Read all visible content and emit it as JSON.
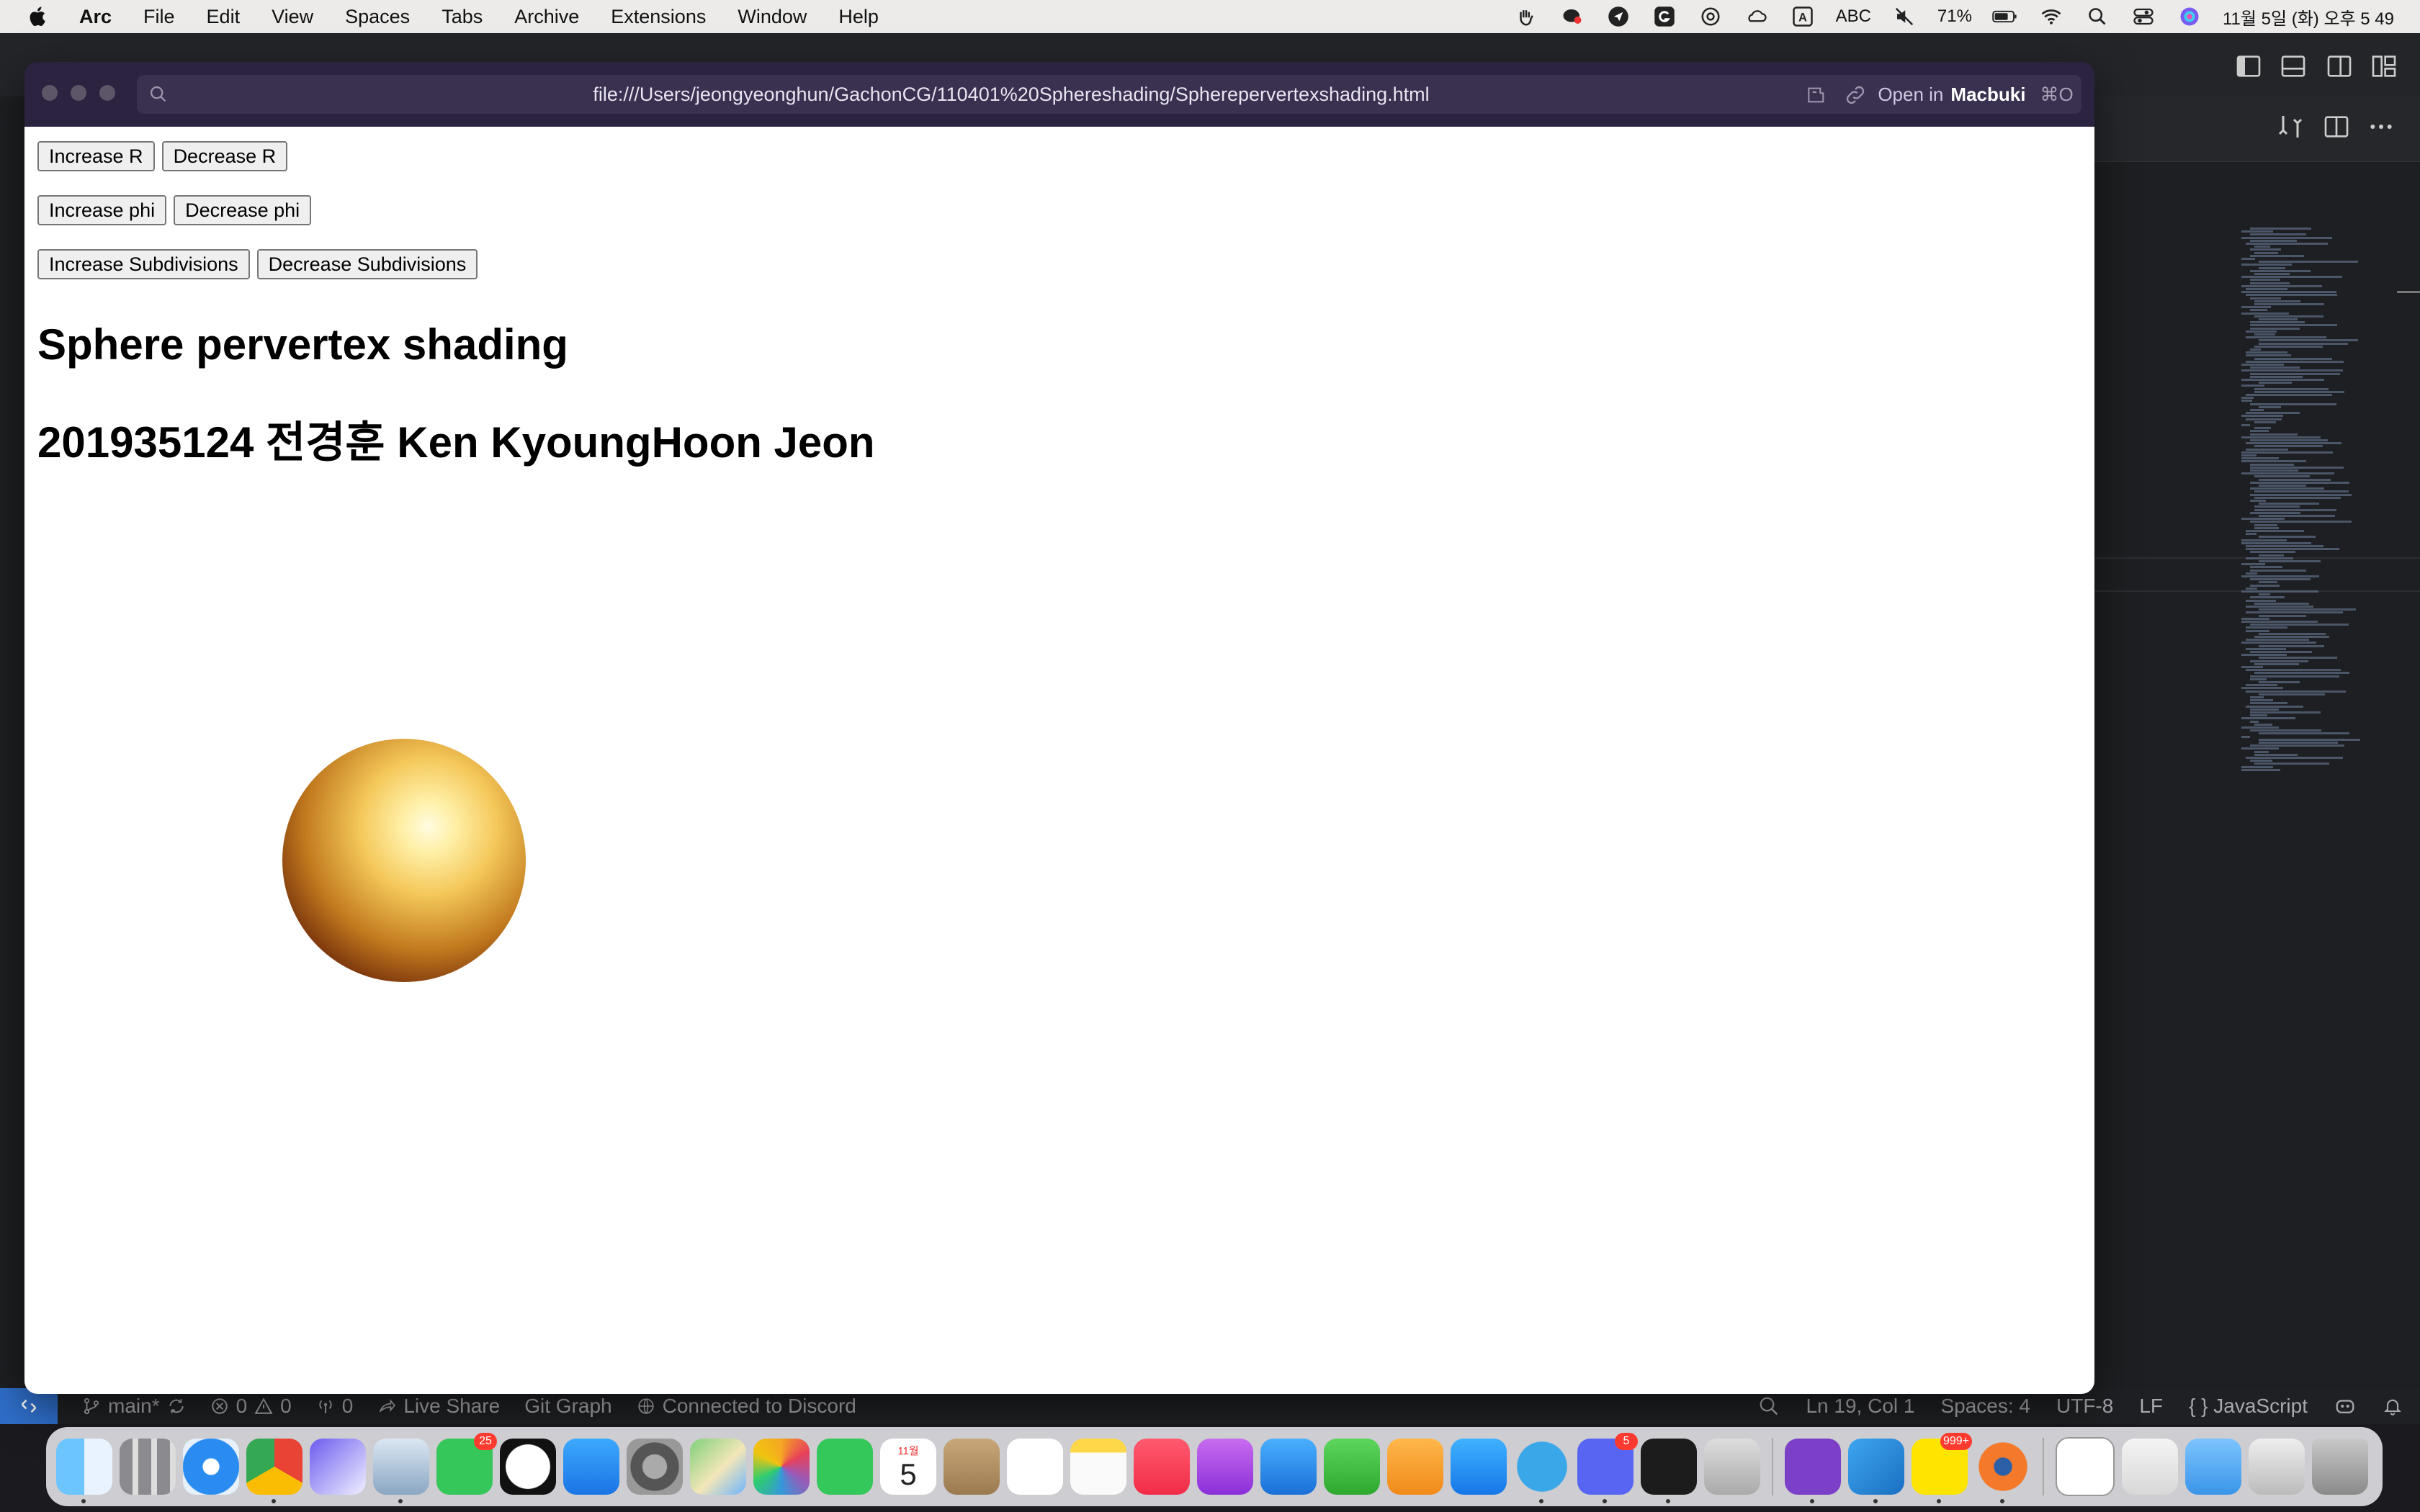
{
  "menubar": {
    "app": "Arc",
    "items": [
      "File",
      "Edit",
      "View",
      "Spaces",
      "Tabs",
      "Archive",
      "Extensions",
      "Window",
      "Help"
    ],
    "status": {
      "input_source_letter": "A",
      "input_source": "ABC",
      "battery": "71%",
      "datetime": "11월 5일 (화) 오후 5 49"
    }
  },
  "browser": {
    "url": "file:///Users/jeongyeonghun/GachonCG/110401%20Sphereshading/Spherepervertexshading.html",
    "open_in": {
      "prefix": "Open in",
      "app": "Macbuki",
      "shortcut": "⌘O"
    }
  },
  "page": {
    "buttons_r": [
      "Increase R",
      "Decrease R"
    ],
    "buttons_phi": [
      "Increase phi",
      "Decrease phi"
    ],
    "buttons_sub": [
      "Increase Subdivisions",
      "Decrease Subdivisions"
    ],
    "title": "Sphere pervertex shading",
    "subtitle": "201935124 전경훈 Ken KyoungHoon Jeon"
  },
  "vscode_status": {
    "branch": "main*",
    "errors": "0",
    "warnings": "0",
    "ports": "0",
    "live_share": "Live Share",
    "git_graph": "Git Graph",
    "discord": "Connected to Discord",
    "cursor": "Ln 19, Col 1",
    "spaces": "Spaces: 4",
    "encoding": "UTF-8",
    "eol": "LF",
    "language": "JavaScript"
  },
  "dock": {
    "badges": {
      "messages": "25",
      "discord": "5",
      "kakaotalk": "999+"
    },
    "calendar_month": "11월",
    "calendar_day": "5"
  },
  "colors": {
    "arc_theme": "#2b2340",
    "vscode_bg": "#1e1f22",
    "remote_blue": "#2f6fcb"
  }
}
